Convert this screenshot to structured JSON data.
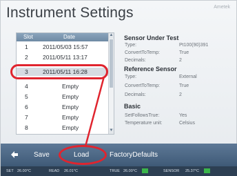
{
  "title": "Instrument Settings",
  "logo_text": "Ametek",
  "slot_list": {
    "headers": {
      "slot": "Slot",
      "date": "Date"
    },
    "rows": [
      {
        "slot": "1",
        "date": "2011/05/03 15:57"
      },
      {
        "slot": "2",
        "date": "2011/05/11 13:17"
      },
      {
        "slot": "3",
        "date": "2011/05/11 16:28"
      },
      {
        "slot": "4",
        "date": "Empty"
      },
      {
        "slot": "5",
        "date": "Empty"
      },
      {
        "slot": "6",
        "date": "Empty"
      },
      {
        "slot": "7",
        "date": "Empty"
      },
      {
        "slot": "8",
        "date": "Empty"
      }
    ],
    "selected_slot": "3"
  },
  "info": {
    "sensor_under_test": {
      "heading": "Sensor Under Test",
      "type_label": "Type:",
      "type_value": "Pt100(90)391",
      "convert_label": "ConvertToTemp:",
      "convert_value": "True",
      "decimals_label": "Decimals:",
      "decimals_value": "2"
    },
    "reference_sensor": {
      "heading": "Reference Sensor",
      "type_label": "Type:",
      "type_value": "External",
      "convert_label": "ConvertToTemp:",
      "convert_value": "True",
      "decimals_label": "Decimals:",
      "decimals_value": "2"
    },
    "basic": {
      "heading": "Basic",
      "selffollow_label": "SetFollowsTrue:",
      "selffollow_value": "Yes",
      "unit_label": "Temperature unit:",
      "unit_value": "Celsius"
    }
  },
  "toolbar": {
    "save_label": "Save",
    "load_label": "Load",
    "factory_label": "FactoryDefaults"
  },
  "status_bar": {
    "set_label": "SET",
    "set_value": "26.00°C",
    "read_label": "READ",
    "read_value": "26.01°C",
    "true_label": "TRUE",
    "true_value": "26.00°C",
    "sensor_label": "SENSOR",
    "sensor_value": "25.37°C"
  },
  "colors": {
    "accent_red": "#e0242e",
    "toolbar": "#4b6684",
    "status_ok": "#3bb54a"
  }
}
